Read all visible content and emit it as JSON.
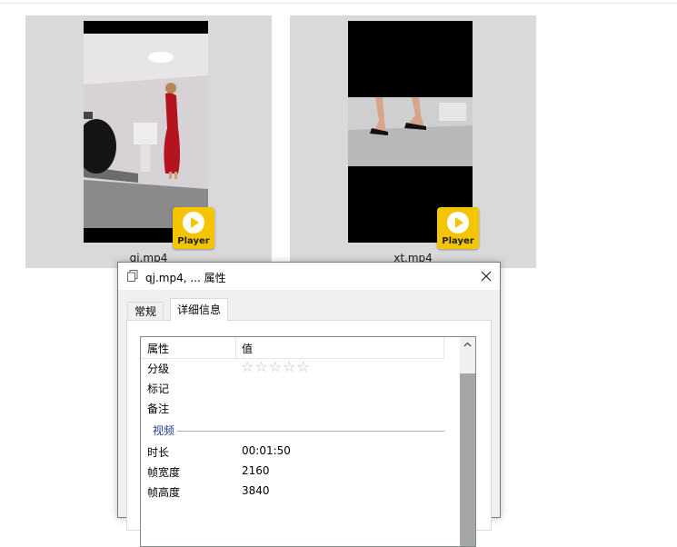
{
  "files": [
    {
      "name": "qj.mp4",
      "badge_label": "Player"
    },
    {
      "name": "xt.mp4",
      "badge_label": "Player"
    }
  ],
  "dialog": {
    "title": "qj.mp4, ... 属性",
    "tabs": [
      {
        "label": "常规",
        "active": false
      },
      {
        "label": "详细信息",
        "active": true
      }
    ],
    "columns": {
      "name": "属性",
      "value": "值"
    },
    "rows": [
      {
        "key": "分级",
        "value": "☆☆☆☆☆"
      },
      {
        "key": "标记",
        "value": ""
      },
      {
        "key": "备注",
        "value": ""
      }
    ],
    "group_label": "视频",
    "video_rows": [
      {
        "key": "时长",
        "value": "00:01:50"
      },
      {
        "key": "帧宽度",
        "value": "2160"
      },
      {
        "key": "帧高度",
        "value": "3840"
      }
    ]
  },
  "colors": {
    "tile_bg": "#d9d9d9",
    "badge": "#f5c400",
    "group_text": "#1e3f8a"
  }
}
